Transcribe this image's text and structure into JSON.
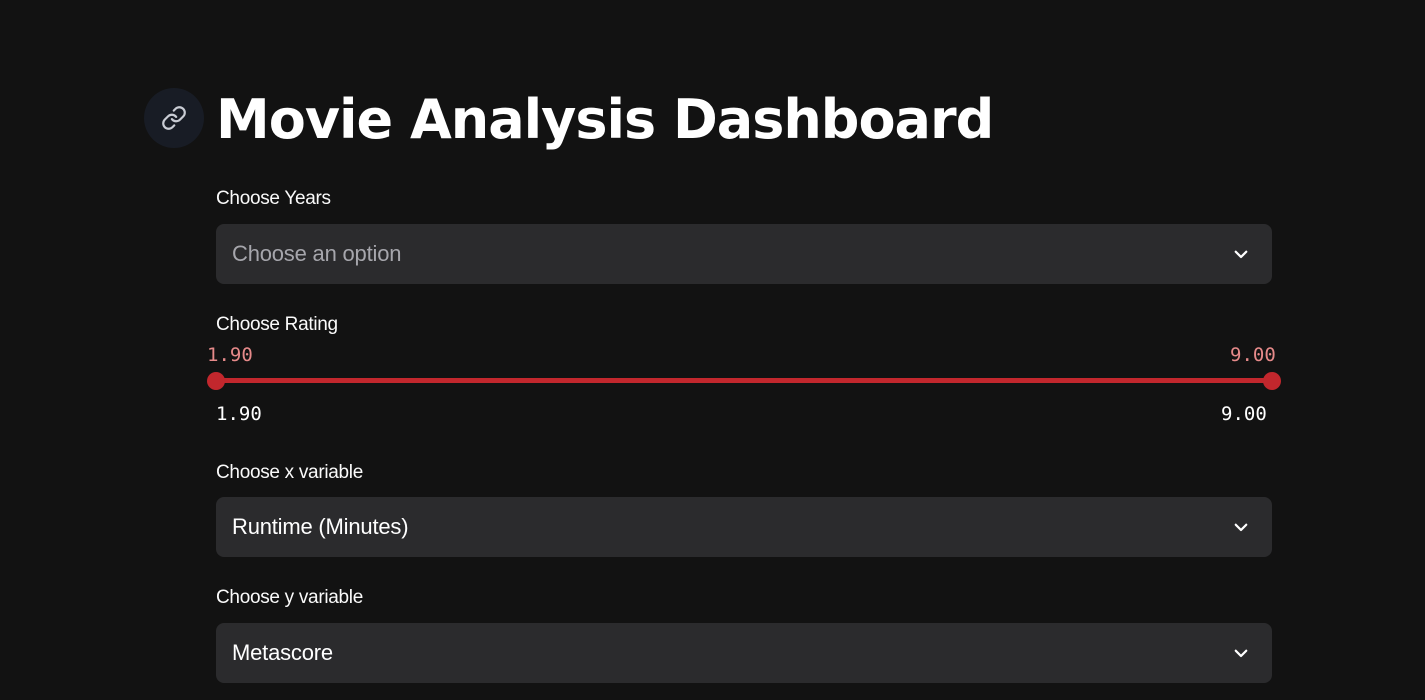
{
  "header": {
    "title": "Movie Analysis Dashboard",
    "anchor_icon": "link-icon"
  },
  "years_filter": {
    "label": "Choose Years",
    "placeholder": "Choose an option"
  },
  "rating_filter": {
    "label": "Choose Rating",
    "low_value": "1.90",
    "high_value": "9.00",
    "min_label": "1.90",
    "max_label": "9.00",
    "accent_color": "#c2272d"
  },
  "x_variable": {
    "label": "Choose x variable",
    "value": "Runtime (Minutes)"
  },
  "y_variable": {
    "label": "Choose y variable",
    "value": "Metascore"
  },
  "theme": {
    "background": "#121212",
    "input_background": "#2b2b2d",
    "accent": "#c2272d"
  }
}
